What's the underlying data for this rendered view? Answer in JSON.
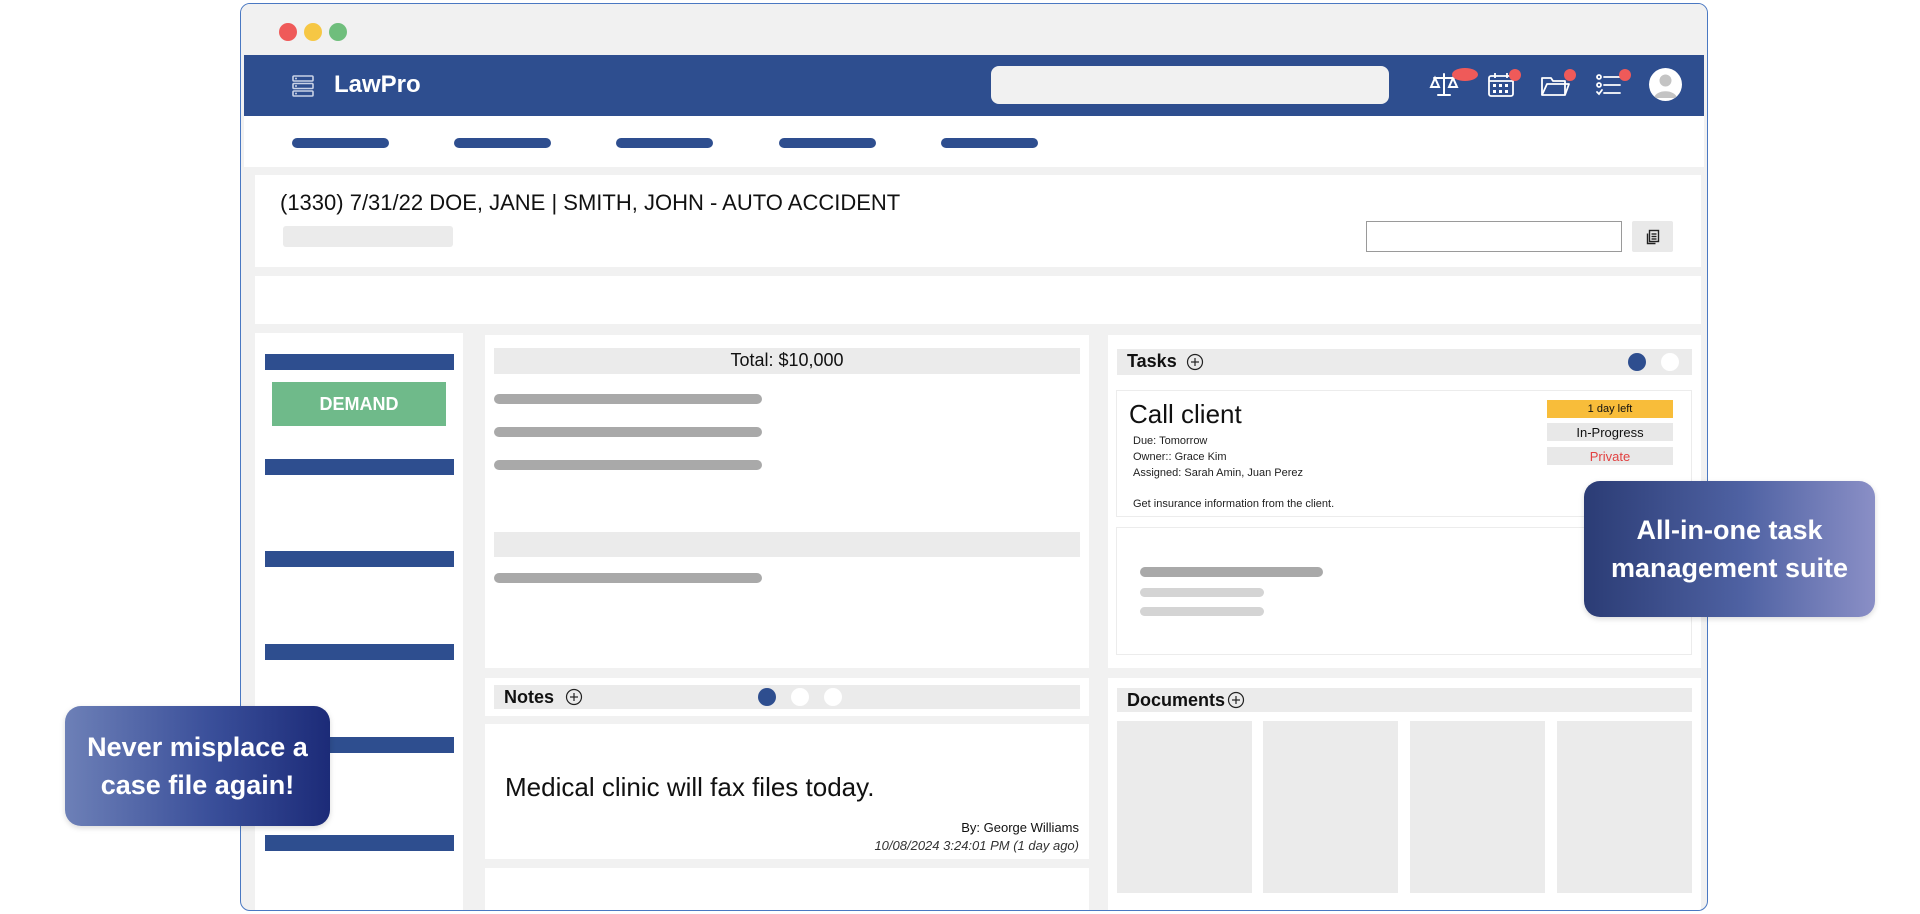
{
  "app": {
    "name": "LawPro",
    "colors": {
      "primary": "#2e4e8f",
      "accent_green": "#6fba8a",
      "alert_red": "#ef5a59",
      "warning_yellow": "#f8bd3a"
    },
    "header_icons": [
      "scales-icon",
      "calendar-icon",
      "folder-icon",
      "task-list-icon",
      "user-avatar-icon"
    ],
    "search": {
      "placeholder": ""
    }
  },
  "case": {
    "title": "(1330) 7/31/22 DOE, JANE  | SMITH, JOHN - AUTO ACCIDENT"
  },
  "sidebar": {
    "demand_label": "DEMAND"
  },
  "financials": {
    "total_label": "Total: $10,000"
  },
  "tasks": {
    "title": "Tasks",
    "pager": {
      "count": 2,
      "active": 1
    },
    "items": [
      {
        "title": "Call client",
        "due": "Due: Tomorrow",
        "owner": "Owner:: Grace Kim",
        "assigned": "Assigned: Sarah Amin, Juan Perez",
        "description": "Get insurance information from the client.",
        "time_left": "1 day left",
        "status": "In-Progress",
        "visibility": "Private"
      }
    ]
  },
  "notes": {
    "title": "Notes",
    "pager": {
      "count": 3,
      "active": 1
    },
    "items": [
      {
        "text": "Medical clinic will fax files today.",
        "by": "By: George Williams",
        "date": "10/08/2024 3:24:01 PM (1 day ago)"
      }
    ]
  },
  "documents": {
    "title": "Documents"
  },
  "callouts": {
    "right": "All-in-one task management suite",
    "left": "Never misplace a case file again!"
  }
}
